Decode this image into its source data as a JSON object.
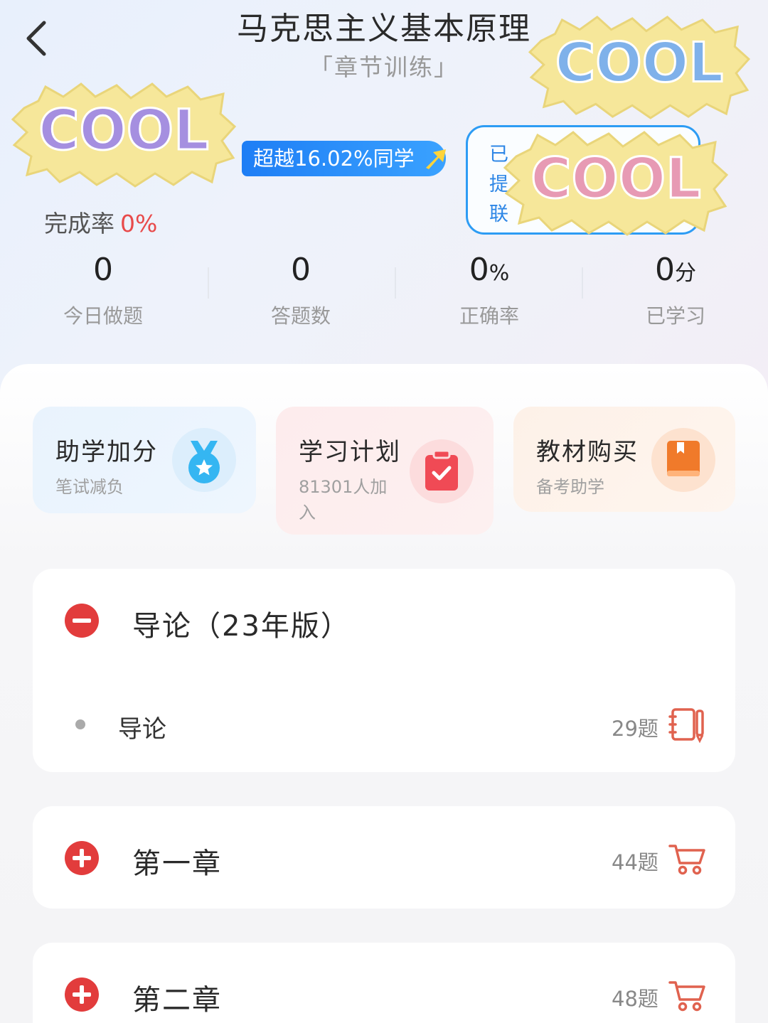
{
  "header": {
    "title": "马克思主义基本原理",
    "subtitle": "「章节训练」",
    "beat_badge": "超越16.02%同学",
    "notice_lines": [
      "已",
      "提",
      "联"
    ],
    "sticker_text": "COOL"
  },
  "completion": {
    "label": "完成率",
    "value": "0%"
  },
  "stats": [
    {
      "value": "0",
      "unit": "",
      "label": "今日做题"
    },
    {
      "value": "0",
      "unit": "",
      "label": "答题数"
    },
    {
      "value": "0",
      "unit": "%",
      "label": "正确率"
    },
    {
      "value": "0",
      "unit": "分",
      "label": "已学习"
    }
  ],
  "quick_actions": [
    {
      "title": "助学加分",
      "subtitle": "笔试减负",
      "icon": "medal-icon",
      "color": "#35b6f2"
    },
    {
      "title": "学习计划",
      "subtitle": "81301人加入",
      "icon": "clipboard-check-icon",
      "color": "#f04a55"
    },
    {
      "title": "教材购买",
      "subtitle": "备考助学",
      "icon": "book-icon",
      "color": "#f07a2a"
    }
  ],
  "chapters": [
    {
      "title": "导论（23年版）",
      "expanded": true,
      "sections": [
        {
          "title": "导论",
          "count": "29题",
          "icon": "notebook-pen-icon"
        }
      ]
    },
    {
      "title": "第一章",
      "expanded": false,
      "count": "44题",
      "icon": "cart-icon"
    },
    {
      "title": "第二章",
      "expanded": false,
      "count": "48题",
      "icon": "cart-icon"
    }
  ],
  "colors": {
    "accent_red": "#e23c3c",
    "accent_blue": "#2d9cf4",
    "badge_blue": "#1e7ef5"
  }
}
